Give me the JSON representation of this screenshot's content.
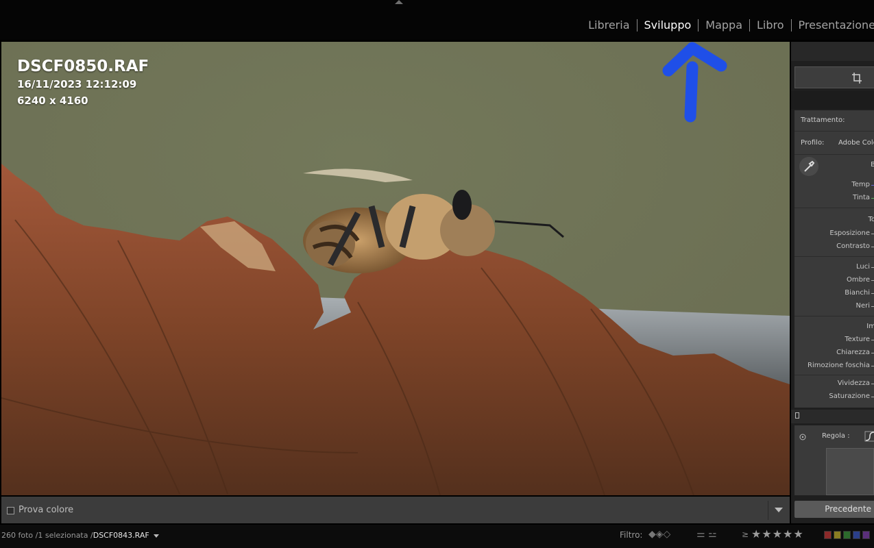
{
  "modules": [
    {
      "label": "Libreria",
      "active": false
    },
    {
      "label": "Sviluppo",
      "active": true
    },
    {
      "label": "Mappa",
      "active": false
    },
    {
      "label": "Libro",
      "active": false
    },
    {
      "label": "Presentazione",
      "active": false
    }
  ],
  "photo_info": {
    "filename": "DSCF0850.RAF",
    "datetime": "16/11/2023 12:12:09",
    "dimensions": "6240 x 4160"
  },
  "develop_panel": {
    "treatment_label": "Trattamento:",
    "profile_label": "Profilo:",
    "profile_value": "Adobe Color",
    "white_balance_heading": "B",
    "temp_label": "Temp",
    "tint_label": "Tinta",
    "tone_heading": "To",
    "exposure_label": "Esposizione",
    "contrast_label": "Contrasto",
    "highlights_label": "Luci",
    "shadows_label": "Ombre",
    "whites_label": "Bianchi",
    "blacks_label": "Neri",
    "presence_heading": "Im",
    "texture_label": "Texture",
    "clarity_label": "Chiarezza",
    "dehaze_label": "Rimozione foschia",
    "vibrance_label": "Vividezza",
    "saturation_label": "Saturazione",
    "adjust_label": "Regola :",
    "previous_button": "Precedente"
  },
  "toolbar": {
    "softproof_label": "Prova colore"
  },
  "filmstrip": {
    "count": "260 foto",
    "selected": "/1 selezionata",
    "path_sep": "/",
    "current_file": "DSCF0843.RAF",
    "filter_label": "Filtro:",
    "rating_operator": "≥",
    "stars": "★★★★★"
  },
  "colors": {
    "accent_arrow": "#1f4fe8",
    "label_red": "#8b2a2a",
    "label_yellow": "#8a7d22",
    "label_green": "#2c6a2c",
    "label_blue": "#2b3f8a",
    "label_purple": "#5a2f7a"
  }
}
